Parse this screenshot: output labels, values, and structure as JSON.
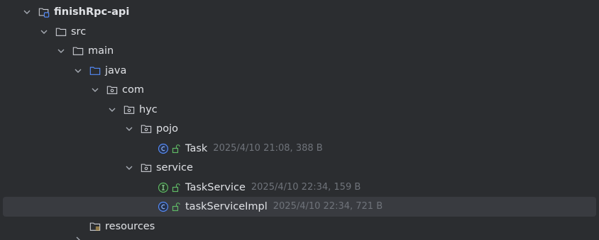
{
  "colors": {
    "background": "#2b2d30",
    "selected_row": "#393b40",
    "text": "#dfe1e5",
    "meta_text": "#6f737a",
    "module_accent": "#548af7",
    "source_folder": "#548af7",
    "class_icon": "#548af7",
    "interface_icon": "#5fb865",
    "access_badge": "#5fb865",
    "resources_badge": "#d6ae58"
  },
  "tree": {
    "module": {
      "label": "finishRpc-api",
      "icon": "module-folder-icon"
    },
    "src": {
      "label": "src",
      "icon": "folder-icon"
    },
    "main": {
      "label": "main",
      "icon": "folder-icon"
    },
    "java": {
      "label": "java",
      "icon": "source-root-folder-icon"
    },
    "com": {
      "label": "com",
      "icon": "package-icon"
    },
    "hyc": {
      "label": "hyc",
      "icon": "package-icon"
    },
    "pojo": {
      "label": "pojo",
      "icon": "package-icon"
    },
    "task": {
      "label": "Task",
      "meta": "2025/4/10 21:08, 388 B",
      "icon": "class-icon"
    },
    "service": {
      "label": "service",
      "icon": "package-icon"
    },
    "task_service": {
      "label": "TaskService",
      "meta": "2025/4/10 22:34, 159 B",
      "icon": "interface-icon"
    },
    "task_service_impl": {
      "label": "taskServiceImpl",
      "meta": "2025/4/10 22:34, 721 B",
      "icon": "class-icon",
      "selected": true
    },
    "resources": {
      "label": "resources",
      "icon": "resources-folder-icon"
    }
  }
}
